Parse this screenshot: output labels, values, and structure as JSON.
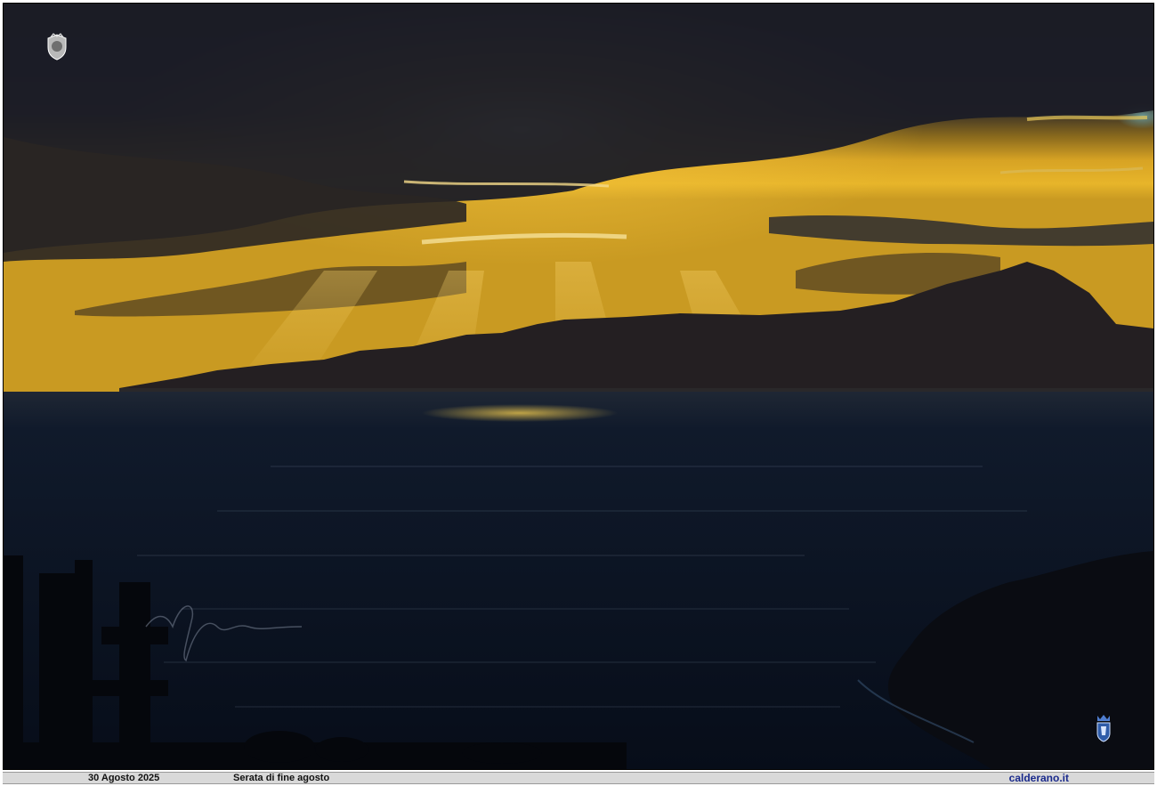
{
  "caption": {
    "date": "30 Agosto 2025",
    "title": "Serata di fine agosto",
    "site": "calderano.it"
  },
  "photo": {
    "scene": "Sunset over the sea with crepuscular rays behind a mountainous island silhouette",
    "logos": {
      "top_left": "crest-icon",
      "bottom_right": "coat-of-arms-icon"
    },
    "watermark": "signature"
  },
  "colors": {
    "sky_gold": "#e7b52a",
    "sky_dark": "#1a1c27",
    "sea": "#0a1424",
    "caption_bar": "#d9d9d9",
    "site_link": "#1a2a8c"
  }
}
